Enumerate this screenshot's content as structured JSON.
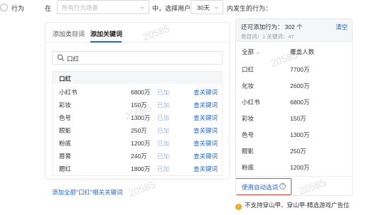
{
  "filter": {
    "label": "行为",
    "in_label": "在",
    "scene_placeholder": "所有行为场景",
    "middle_label": "中，选择用户",
    "days_value": "30天",
    "tail_label": "内发生的行为："
  },
  "left": {
    "tabs": [
      "添加类目词",
      "添加关键词"
    ],
    "search_value": "口红",
    "group_title": "口红",
    "rows": [
      {
        "name": "小红书",
        "count": "6800万",
        "status": "已加",
        "action": "查关键词"
      },
      {
        "name": "彩妆",
        "count": "150万",
        "status": "已加",
        "action": "查关键词"
      },
      {
        "name": "色号",
        "count": "1300万",
        "status": "已加",
        "action": "查关键词"
      },
      {
        "name": "眼影",
        "count": "250万",
        "status": "已加",
        "action": "查关键词"
      },
      {
        "name": "粉底",
        "count": "1200万",
        "status": "已加",
        "action": "查关键词"
      },
      {
        "name": "唇膏",
        "count": "240万",
        "status": "已加",
        "action": "查关键词"
      },
      {
        "name": "腮红",
        "count": "1800万",
        "status": "已加",
        "action": "查关键词"
      }
    ],
    "add_all_link": "添加全部\"口红\"相关关键词"
  },
  "right": {
    "title": "还可添加行为：",
    "remaining": "302 个",
    "sub": "类目词：1    关键词：47",
    "clear": "清空",
    "col1": "全部",
    "col2": "覆盖人数",
    "rows": [
      {
        "k": "口红",
        "v": "7700万"
      },
      {
        "k": "化妆",
        "v": "2600万"
      },
      {
        "k": "小红书",
        "v": "6800万"
      },
      {
        "k": "彩妆",
        "v": "150万"
      },
      {
        "k": "色号",
        "v": "1300万"
      },
      {
        "k": "眼影",
        "v": "250万"
      },
      {
        "k": "粉底",
        "v": "1200万"
      }
    ],
    "auto_pick": "使用自动选词"
  },
  "warning": "不支持穿山甲、穿山甲-精选游戏广告位",
  "watermark": "20585",
  "colors": {
    "accent": "#1a66d6",
    "highlight_border": "#e2463f",
    "warn": "#f5a623"
  }
}
